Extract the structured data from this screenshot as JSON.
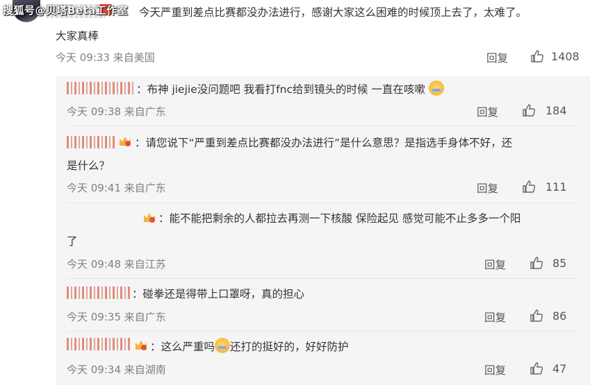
{
  "watermark": "搜狐号@贝塔Beta工作室",
  "main": {
    "text_line1": "今天严重到差点比赛都没办法进行，感谢大家这么困难的时候顶上去了，太难了。",
    "text_line2": "大家真棒",
    "time": "今天 09:33 来自美国",
    "reply_label": "回复",
    "likes": "1408"
  },
  "replies": [
    {
      "prefix": "：",
      "text": "布神 jiejie没问题吧 我看打fnc给到镜头的时候 一直在咳嗽",
      "emoji": "crying-face",
      "time": "今天 09:38 来自广东",
      "reply_label": "回复",
      "likes": "184"
    },
    {
      "prefix": "：",
      "text1": "请您说下“严重到差点比赛都没办法进行”是什么意思？是指选手身体不好，还",
      "text2": "是什么？",
      "time": "今天 09:41 来自广东",
      "reply_label": "回复",
      "likes": "111"
    },
    {
      "prefix": "：",
      "text1": "能不能把剩余的人都拉去再测一下核酸 保险起见 感觉可能不止多多一个阳",
      "text2": "了",
      "time": "今天 09:48 来自江苏",
      "reply_label": "回复",
      "likes": "85"
    },
    {
      "prefix": "：",
      "text": "碰拳还是得带上口罩呀，真的担心",
      "time": "今天 09:35 来自广东",
      "reply_label": "回复",
      "likes": "86"
    },
    {
      "prefix": "：",
      "text_a": "这么严重吗",
      "emoji": "crying-face",
      "text_b": "还打的挺好的，好好防护",
      "time": "今天 09:34 来自湖南",
      "reply_label": "回复",
      "likes": "47"
    }
  ]
}
